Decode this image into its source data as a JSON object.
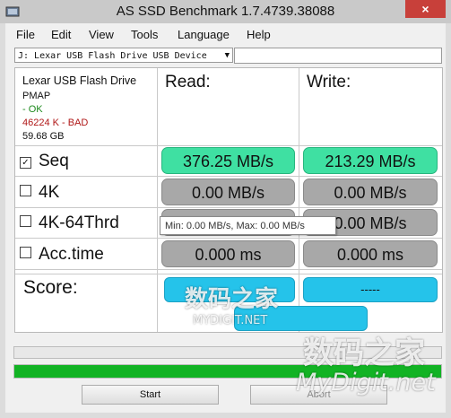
{
  "window": {
    "title": "AS SSD Benchmark 1.7.4739.38088",
    "close_label": "×"
  },
  "menu": [
    "File",
    "Edit",
    "View",
    "Tools",
    "Language",
    "Help"
  ],
  "drive_select": {
    "value": "J: Lexar USB Flash Drive USB Device"
  },
  "device_info": {
    "name": "Lexar USB Flash Drive",
    "driver": "PMAP",
    "driver_status": " - OK",
    "alignment": "46224 K - BAD",
    "size": "59.68 GB"
  },
  "columns": {
    "read": "Read:",
    "write": "Write:"
  },
  "rows": [
    {
      "label": "Seq",
      "checked": true,
      "read": "376.25 MB/s",
      "write": "213.29 MB/s"
    },
    {
      "label": "4K",
      "checked": false,
      "read": "0.00 MB/s",
      "write": "0.00 MB/s"
    },
    {
      "label": "4K-64Thrd",
      "checked": false,
      "read": "0.00 MB/s",
      "write": "0.00 MB/s"
    },
    {
      "label": "Acc.time",
      "checked": false,
      "read": "0.000 ms",
      "write": "0.000 ms"
    }
  ],
  "score": {
    "label": "Score:",
    "read": "",
    "write": "-----",
    "total": ""
  },
  "tooltip": "Min: 0.00 MB/s, Max: 0.00 MB/s",
  "progress": {
    "top_fraction": 0.0,
    "bottom_fraction": 1.0
  },
  "buttons": {
    "start": "Start",
    "abort": "Abort"
  },
  "watermarks": {
    "mid": "数码之家",
    "mid_sub": "MYDIGIT.NET",
    "corner": "数码之家",
    "corner_sub": "MyDigit.net"
  },
  "colors": {
    "result_green": "#3fe0a2",
    "result_gray": "#a8a8a8",
    "score_blue": "#25c3ea",
    "progress_green": "#12b324",
    "bad_red": "#b01818",
    "ok_green": "#1e8a1e"
  }
}
